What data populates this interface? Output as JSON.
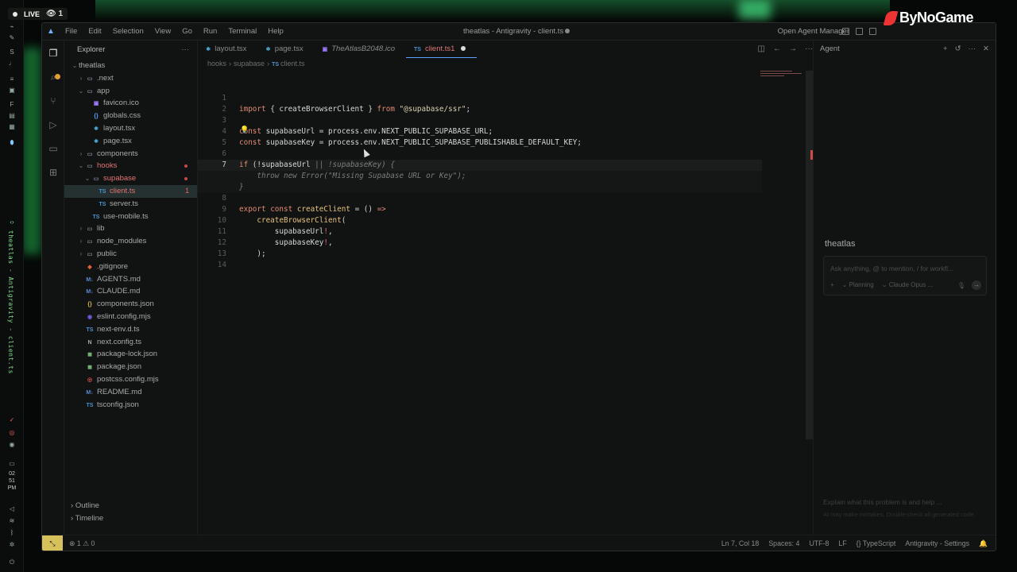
{
  "overlay": {
    "live_label": "LIVE",
    "viewers": "1",
    "brand": "ByNoGame",
    "vertical_title": "theatlas - Antigravity - client.ts",
    "clock": [
      "02",
      "51",
      "PM"
    ]
  },
  "titlebar": {
    "menu": [
      "File",
      "Edit",
      "Selection",
      "View",
      "Go",
      "Run",
      "Terminal",
      "Help"
    ],
    "window_title": "theatlas - Antigravity - client.ts",
    "agent_manager": "Open Agent Manager"
  },
  "explorer": {
    "title": "Explorer",
    "more": "···",
    "tree": [
      {
        "name": "theatlas",
        "depth": 0,
        "type": "root",
        "chev": "⌄"
      },
      {
        "name": ".next",
        "depth": 1,
        "type": "folder",
        "chev": "›"
      },
      {
        "name": "app",
        "depth": 1,
        "type": "folder",
        "chev": "⌄"
      },
      {
        "name": "favicon.ico",
        "depth": 2,
        "type": "ico"
      },
      {
        "name": "globals.css",
        "depth": 2,
        "type": "css"
      },
      {
        "name": "layout.tsx",
        "depth": 2,
        "type": "react"
      },
      {
        "name": "page.tsx",
        "depth": 2,
        "type": "react"
      },
      {
        "name": "components",
        "depth": 1,
        "type": "folder",
        "chev": "›"
      },
      {
        "name": "hooks",
        "depth": 1,
        "type": "folder",
        "chev": "⌄",
        "error": true,
        "dot": true
      },
      {
        "name": "supabase",
        "depth": 2,
        "type": "folder",
        "chev": "⌄",
        "error": true,
        "dot": true
      },
      {
        "name": "client.ts",
        "depth": 3,
        "type": "ts",
        "error": true,
        "selected": true,
        "count": "1"
      },
      {
        "name": "server.ts",
        "depth": 3,
        "type": "ts"
      },
      {
        "name": "use-mobile.ts",
        "depth": 2,
        "type": "ts"
      },
      {
        "name": "lib",
        "depth": 1,
        "type": "folder",
        "chev": "›"
      },
      {
        "name": "node_modules",
        "depth": 1,
        "type": "folder",
        "chev": "›"
      },
      {
        "name": "public",
        "depth": 1,
        "type": "folder",
        "chev": "›"
      },
      {
        "name": ".gitignore",
        "depth": 1,
        "type": "git"
      },
      {
        "name": "AGENTS.md",
        "depth": 1,
        "type": "md"
      },
      {
        "name": "CLAUDE.md",
        "depth": 1,
        "type": "md"
      },
      {
        "name": "components.json",
        "depth": 1,
        "type": "json"
      },
      {
        "name": "eslint.config.mjs",
        "depth": 1,
        "type": "eslint"
      },
      {
        "name": "next-env.d.ts",
        "depth": 1,
        "type": "ts"
      },
      {
        "name": "next.config.ts",
        "depth": 1,
        "type": "next"
      },
      {
        "name": "package-lock.json",
        "depth": 1,
        "type": "npm"
      },
      {
        "name": "package.json",
        "depth": 1,
        "type": "npm"
      },
      {
        "name": "postcss.config.mjs",
        "depth": 1,
        "type": "postcss"
      },
      {
        "name": "README.md",
        "depth": 1,
        "type": "md"
      },
      {
        "name": "tsconfig.json",
        "depth": 1,
        "type": "tsconfig"
      }
    ],
    "outline": "Outline",
    "timeline": "Timeline"
  },
  "tabs": [
    {
      "label": "layout.tsx",
      "icon": "react",
      "active": false
    },
    {
      "label": "page.tsx",
      "icon": "react",
      "active": false
    },
    {
      "label": "TheAtlasB2048.ico",
      "icon": "image",
      "active": false,
      "italic": true
    },
    {
      "label": "client.ts",
      "icon": "ts",
      "active": true,
      "badge": "1"
    }
  ],
  "breadcrumb": [
    "hooks",
    "supabase",
    "client.ts"
  ],
  "editor": {
    "lines": [
      {
        "n": "1",
        "html": ""
      },
      {
        "n": "2",
        "html": "<span class='kw'>import</span> { createBrowserClient } <span class='kw'>from</span> <span class='str'>\"@supabase/ssr\"</span>;"
      },
      {
        "n": "3",
        "html": ""
      },
      {
        "n": "4",
        "html": "<span class='kw'>const</span> supabaseUrl = process.env.NEXT_PUBLIC_SUPABASE_URL;"
      },
      {
        "n": "5",
        "html": "<span class='kw'>const</span> supabaseKey = process.env.NEXT_PUBLIC_SUPABASE_PUBLISHABLE_DEFAULT_KEY;"
      },
      {
        "n": "6",
        "html": ""
      },
      {
        "n": "7",
        "html": "<span class='kw'>if</span> (!supabaseUrl <span class='cm'>|| !supabaseKey) {</span>",
        "hl": true,
        "cur": true
      },
      {
        "n": "",
        "html": "    <span class='cm'>throw new Error(\"Missing Supabase URL or Key\");</span>",
        "hl2": true
      },
      {
        "n": "",
        "html": "<span class='cm'>}</span>",
        "hl2": true
      },
      {
        "n": "8",
        "html": ""
      },
      {
        "n": "9",
        "html": "<span class='kw'>export</span> <span class='kw'>const</span> <span class='fn'>createClient</span> = () <span class='kw'>=&gt;</span>"
      },
      {
        "n": "10",
        "html": "    <span class='fn'>createBrowserClient</span>("
      },
      {
        "n": "11",
        "html": "        supabaseUrl<span class='err'>!</span>,"
      },
      {
        "n": "12",
        "html": "        supabaseKey<span class='err'>!</span>,"
      },
      {
        "n": "13",
        "html": "    );"
      },
      {
        "n": "14",
        "html": ""
      }
    ]
  },
  "agent": {
    "title": "Agent",
    "project": "theatlas",
    "placeholder": "Ask anything, @ to mention, / for workfl...",
    "mode": "Planning",
    "model": "Claude Opus ...",
    "problem_hint": "Explain what this problem is and help ...",
    "disclaimer": "AI may make mistakes. Double-check all generated code."
  },
  "statusbar": {
    "errors": "1",
    "warnings": "0",
    "position": "Ln 7, Col 18",
    "spaces": "Spaces: 4",
    "encoding": "UTF-8",
    "eol": "LF",
    "language": "{} TypeScript",
    "settings": "Antigravity - Settings"
  },
  "colors": {
    "accent": "#5aa0ff",
    "error": "#e06060",
    "remote": "#d7c15a",
    "live_green": "#3ad07a"
  }
}
